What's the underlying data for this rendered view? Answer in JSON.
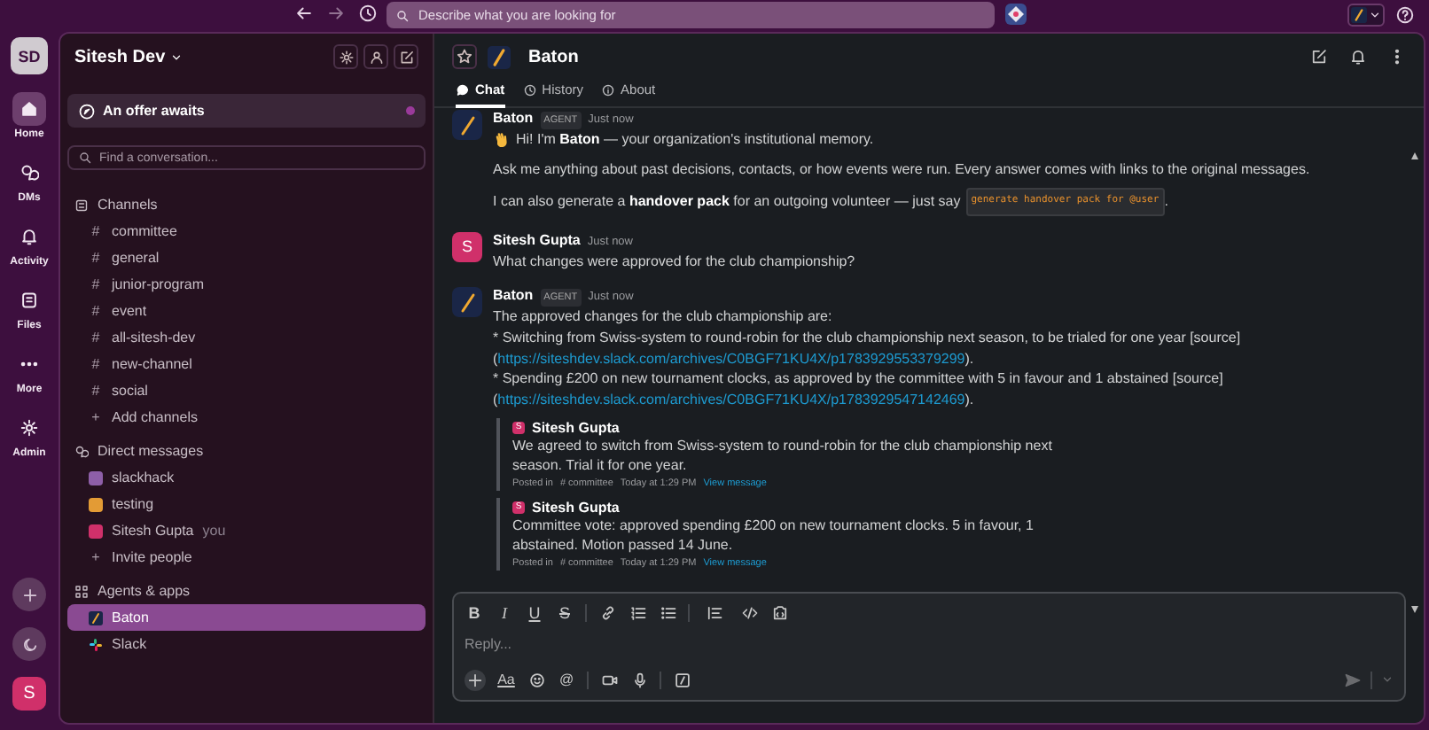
{
  "top_bar": {
    "search_placeholder": "Describe what you are looking for"
  },
  "rail": {
    "workspace": "SD",
    "items": [
      {
        "kind": "home",
        "label": "Home",
        "selected": true
      },
      {
        "kind": "dms",
        "label": "DMs",
        "selected": false
      },
      {
        "kind": "activity",
        "label": "Activity",
        "selected": false
      },
      {
        "kind": "files",
        "label": "Files",
        "selected": false
      },
      {
        "kind": "more",
        "label": "More",
        "selected": false
      },
      {
        "kind": "admin",
        "label": "Admin",
        "selected": false
      }
    ],
    "user_avatar": "S"
  },
  "sidebar": {
    "title": "Sitesh Dev",
    "promo": "An offer awaits",
    "search_placeholder": "Find a conversation...",
    "sections": [
      {
        "kind": "channels",
        "title": "Channels",
        "items": [
          {
            "kind": "channel",
            "prefix": "#",
            "label": "committee",
            "selected": false
          },
          {
            "kind": "channel",
            "prefix": "#",
            "label": "general",
            "selected": false
          },
          {
            "kind": "channel",
            "prefix": "#",
            "label": "junior-program",
            "selected": false
          },
          {
            "kind": "channel",
            "prefix": "#",
            "label": "event",
            "selected": false
          },
          {
            "kind": "channel",
            "prefix": "#",
            "label": "all-sitesh-dev",
            "selected": false
          },
          {
            "kind": "channel",
            "prefix": "#",
            "label": "new-channel",
            "selected": false
          },
          {
            "kind": "channel",
            "prefix": "#",
            "label": "social",
            "selected": false
          },
          {
            "kind": "action",
            "prefix": "+",
            "label": "Add channels",
            "selected": false
          }
        ]
      },
      {
        "kind": "dms",
        "title": "Direct messages",
        "items": [
          {
            "kind": "person",
            "label": "slackhack",
            "color": "#8e5fa8",
            "selected": false
          },
          {
            "kind": "person",
            "label": "testing",
            "color": "#e39b35",
            "selected": false
          },
          {
            "kind": "person",
            "label": "Sitesh Gupta",
            "suffix": "you",
            "color": "#d0306a",
            "selected": false
          },
          {
            "kind": "action",
            "prefix": "+",
            "label": "Invite people",
            "selected": false
          }
        ]
      },
      {
        "kind": "apps",
        "title": "Agents & apps",
        "items": [
          {
            "kind": "baton-app",
            "label": "Baton",
            "selected": true
          },
          {
            "kind": "slack-app",
            "label": "Slack",
            "selected": false
          }
        ]
      }
    ]
  },
  "channel": {
    "title": "Baton",
    "tabs": [
      {
        "kind": "chat",
        "label": "Chat",
        "selected": true
      },
      {
        "kind": "history",
        "label": "History",
        "selected": false
      },
      {
        "kind": "about",
        "label": "About",
        "selected": false
      }
    ]
  },
  "messages": [
    {
      "kind": "agent",
      "author": "Baton",
      "badge": "AGENT",
      "time": "Just now",
      "paragraphs": [
        [
          {
            "kind": "wave"
          },
          {
            "kind": "text",
            "text": "Hi! I'm **Baton** — your organization's institutional memory."
          }
        ],
        [
          {
            "kind": "text",
            "text": "Ask me anything about past decisions, contacts, or how events were run. Every answer comes with links to the original messages."
          }
        ],
        [
          {
            "kind": "text",
            "text": "I can also generate a **handover pack** for an outgoing volunteer — just say"
          },
          {
            "kind": "code",
            "text": "generate handover pack for @user"
          },
          {
            "kind": "text",
            "text": "."
          }
        ]
      ]
    },
    {
      "kind": "user",
      "author": "Sitesh Gupta",
      "avatar": "S",
      "time": "Just now",
      "paragraphs": [
        [
          {
            "kind": "text",
            "text": "What changes were approved for the club championship?"
          }
        ]
      ]
    },
    {
      "kind": "agent",
      "author": "Baton",
      "badge": "AGENT",
      "time": "Just now",
      "lines": [
        [
          {
            "kind": "text",
            "text": "The approved changes for the club championship are:"
          }
        ],
        [
          {
            "kind": "text",
            "text": "* Switching from Swiss-system to round-robin for the club championship next season, to be trialed for one year [source]"
          }
        ],
        [
          {
            "kind": "text",
            "text": "("
          },
          {
            "kind": "link",
            "text": "https://siteshdev.slack.com/archives/C0BGF71KU4X/p1783929553379299"
          },
          {
            "kind": "text",
            "text": ")."
          }
        ],
        [
          {
            "kind": "text",
            "text": "* Spending £200 on new tournament clocks, as approved by the committee with 5 in favour and 1 abstained [source]"
          }
        ],
        [
          {
            "kind": "text",
            "text": "("
          },
          {
            "kind": "link",
            "text": "https://siteshdev.slack.com/archives/C0BGF71KU4X/p1783929547142469"
          },
          {
            "kind": "text",
            "text": ")."
          }
        ]
      ],
      "quotes": [
        {
          "avatar": "S",
          "author": "Sitesh Gupta",
          "text": "We agreed to switch from Swiss-system to round-robin for the club championship next season. Trial it for one year.",
          "posted": "Posted in",
          "channel": "# committee",
          "time": "Today at 1:29 PM",
          "link": "View message"
        },
        {
          "avatar": "S",
          "author": "Sitesh Gupta",
          "text": "Committee vote: approved spending £200 on new tournament clocks. 5 in favour, 1 abstained. Motion passed 14 June.",
          "posted": "Posted in",
          "channel": "# committee",
          "time": "Today at 1:29 PM",
          "link": "View message"
        }
      ]
    }
  ],
  "composer": {
    "placeholder": "Reply...",
    "format_buttons": [
      {
        "kind": "bold",
        "label": "B"
      },
      {
        "kind": "italic",
        "label": "I"
      },
      {
        "kind": "underline",
        "label": "U"
      },
      {
        "kind": "strike",
        "label": "S"
      },
      {
        "kind": "link"
      },
      {
        "kind": "ordered-list"
      },
      {
        "kind": "bullet-list"
      },
      {
        "kind": "quote"
      },
      {
        "kind": "code"
      },
      {
        "kind": "code-block"
      }
    ],
    "actions": [
      {
        "kind": "plus"
      },
      {
        "kind": "format",
        "label": "Aa"
      },
      {
        "kind": "emoji"
      },
      {
        "kind": "mention",
        "label": "@"
      },
      {
        "kind": "video"
      },
      {
        "kind": "mic"
      },
      {
        "kind": "slash"
      }
    ]
  }
}
